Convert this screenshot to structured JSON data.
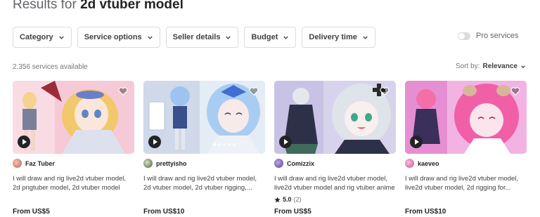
{
  "header": {
    "prefix": "Results for ",
    "query": "2d vtuber model"
  },
  "filters": [
    "Category",
    "Service options",
    "Seller details",
    "Budget",
    "Delivery time"
  ],
  "pro_services": {
    "label": "Pro services",
    "enabled": false
  },
  "results_count": "2,356 services available",
  "sort": {
    "label": "Sort by:",
    "value": "Relevance"
  },
  "gigs": [
    {
      "seller": "Faz Tuber",
      "title": "I will draw and rig live2d vtuber model, 2d pngtuber model, 2d vtuber model",
      "price": "From US$5",
      "rating": null,
      "reviews": null
    },
    {
      "seller": "prettyisho",
      "title": "I will draw and rig live2d vtuber model, 2d vtuber model, 2d vtuber rigging,...",
      "price": "From US$10",
      "rating": null,
      "reviews": null
    },
    {
      "seller": "Comizzix",
      "title": "I will draw and rig live2d vtuber model, live2d vtuber model and rig vtuber anime",
      "price": "From US$5",
      "rating": "5.0",
      "reviews": "(2)"
    },
    {
      "seller": "kaeveo",
      "title": "I will draw and rig live2d vtuber model, live2d vtuber model, 2d rigging for...",
      "price": "From US$10",
      "rating": null,
      "reviews": null
    }
  ],
  "colors": {
    "accent": "#222325",
    "muted": "#74767e",
    "border": "#dadbdd"
  }
}
